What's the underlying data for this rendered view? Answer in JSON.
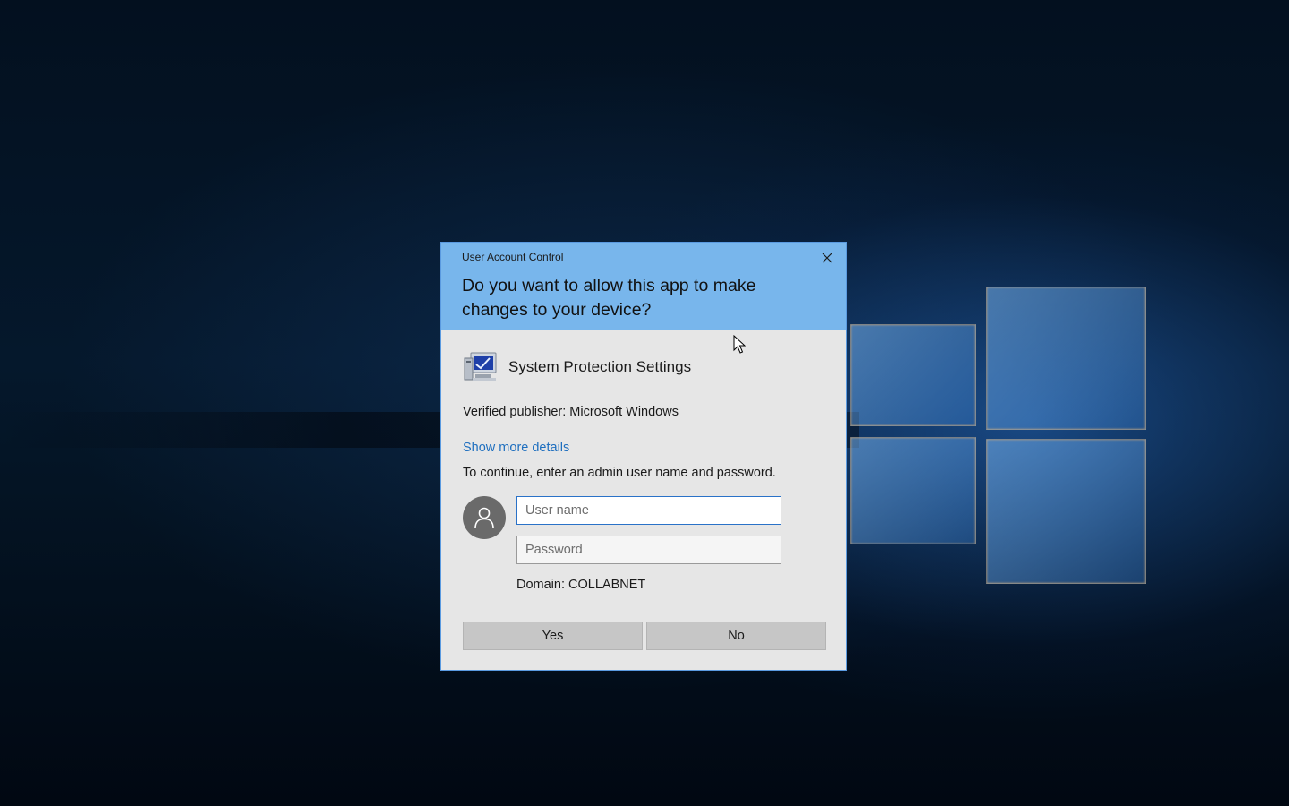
{
  "dialog": {
    "window_title": "User Account Control",
    "question": "Do you want to allow this app to make changes to your device?",
    "app_name": "System Protection Settings",
    "publisher": "Verified publisher: Microsoft Windows",
    "show_more_details": "Show more details",
    "instruction": "To continue, enter an admin user name and password.",
    "username": {
      "value": "",
      "placeholder": "User name"
    },
    "password": {
      "value": "",
      "placeholder": "Password"
    },
    "domain": "Domain: COLLABNET",
    "yes_label": "Yes",
    "no_label": "No"
  },
  "icons": {
    "close": "close-icon",
    "app": "system-protection-icon",
    "avatar": "user-avatar-icon",
    "cursor": "mouse-cursor-icon",
    "wallpaper_logo": "windows-logo"
  },
  "colors": {
    "header": "#78b6ec",
    "body": "#e6e6e6",
    "link": "#1f6fbf",
    "focus_border": "#2a72c8",
    "button": "#c6c6c6"
  }
}
